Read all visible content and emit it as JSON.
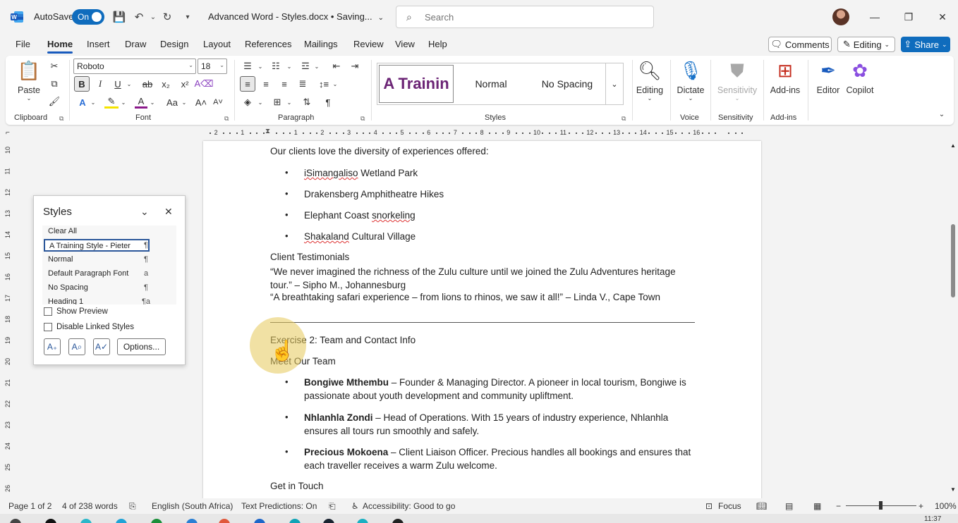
{
  "titlebar": {
    "autosave_label": "AutoSave",
    "autosave_state": "On",
    "doc_title": "Advanced Word - Styles.docx • Saving...",
    "search_placeholder": "Search"
  },
  "menu": {
    "tabs": [
      "File",
      "Home",
      "Insert",
      "Draw",
      "Design",
      "Layout",
      "References",
      "Mailings",
      "Review",
      "View",
      "Help"
    ],
    "active": "Home",
    "comments_label": "Comments",
    "editing_label": "Editing",
    "share_label": "Share"
  },
  "ribbon": {
    "clipboard": {
      "label": "Clipboard",
      "paste_label": "Paste"
    },
    "font": {
      "label": "Font",
      "font_name": "Roboto",
      "font_size": "18"
    },
    "paragraph": {
      "label": "Paragraph"
    },
    "styles": {
      "label": "Styles",
      "tiles": [
        "A Trainin",
        "Normal",
        "No Spacing"
      ]
    },
    "editing": {
      "label": "Editing"
    },
    "voice": {
      "label": "Voice",
      "dictate_label": "Dictate"
    },
    "sensitivity": {
      "label": "Sensitivity",
      "button_label": "Sensitivity"
    },
    "addins": {
      "label": "Add-ins",
      "button_label": "Add-ins"
    },
    "editor_label": "Editor",
    "copilot_label": "Copilot"
  },
  "ruler": {
    "numbers": [
      "1",
      "2",
      "1",
      "2",
      "3",
      "4",
      "5",
      "6",
      "7",
      "8",
      "9",
      "10",
      "11",
      "12",
      "13",
      "14",
      "15",
      "16"
    ],
    "vnumbers": [
      "10",
      "11",
      "12",
      "13",
      "14",
      "15",
      "16",
      "17",
      "18",
      "19",
      "20",
      "21",
      "22",
      "23",
      "24",
      "25",
      "26"
    ]
  },
  "document": {
    "intro": "Our clients love the diversity of experiences offered:",
    "experiences": [
      {
        "squig": "iSimangaliso",
        "rest": " Wetland Park"
      },
      {
        "plain": "Drakensberg Amphitheatre Hikes"
      },
      {
        "pre": "Elephant Coast ",
        "squig": "snorkeling"
      },
      {
        "squig": "Shakaland",
        "rest": " Cultural Village"
      }
    ],
    "testimonials_heading": "Client Testimonials",
    "testimonial_1": "“We never imagined the richness of the Zulu culture until we joined the Zulu Adventures heritage tour.” – Sipho M., Johannesburg",
    "testimonial_2": "“A breathtaking safari experience – from lions to rhinos, we saw it all!” – Linda V., Cape Town",
    "exercise_heading": "Exercise 2: Team and Contact Info",
    "team_heading": "Meet Our Team",
    "team": [
      {
        "name": "Bongiwe Mthembu",
        "desc": " – Founder & Managing Director. A pioneer in local tourism, Bongiwe is passionate about youth development and community upliftment."
      },
      {
        "name": "Nhlanhla Zondi",
        "desc": " – Head of Operations. With 15 years of industry experience, Nhlanhla ensures all tours run smoothly and safely."
      },
      {
        "name": "Precious Mokoena",
        "desc": " – Client Liaison Officer. Precious handles all bookings and ensures that each traveller receives a warm Zulu welcome."
      }
    ],
    "contact_heading": "Get in Touch"
  },
  "styles_pane": {
    "title": "Styles",
    "items": [
      {
        "label": "Clear All",
        "mark": ""
      },
      {
        "label": "A Training Style - Pieter",
        "mark": "¶"
      },
      {
        "label": "Normal",
        "mark": "¶"
      },
      {
        "label": "Default Paragraph Font",
        "mark": "a"
      },
      {
        "label": "No Spacing",
        "mark": "¶"
      },
      {
        "label": "Heading 1",
        "mark": "¶a"
      }
    ],
    "show_preview_label": "Show Preview",
    "disable_linked_label": "Disable Linked Styles",
    "options_label": "Options..."
  },
  "statusbar": {
    "page": "Page 1 of 2",
    "words": "4 of 238 words",
    "language": "English (South Africa)",
    "text_predictions": "Text Predictions: On",
    "accessibility": "Accessibility: Good to go",
    "focus": "Focus",
    "zoom": "100%"
  },
  "taskbar": {
    "clock": "11:37"
  },
  "colors": {
    "accent": "#0f6cbd",
    "style_purple": "#6b2475",
    "highlight": "#e6c85a"
  }
}
